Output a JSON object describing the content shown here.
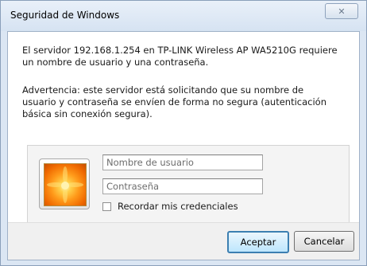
{
  "dialog": {
    "title": "Seguridad de Windows",
    "close_symbol": "☒",
    "message_1": "El servidor 192.168.1.254 en TP-LINK Wireless AP WA5210G requiere un nombre de usuario y una contraseña.",
    "message_2": "Advertencia: este servidor está solicitando que su nombre de usuario y contraseña se envíen de forma no segura (autenticación básica sin conexión segura)."
  },
  "credentials": {
    "avatar_icon": "user-flower-icon",
    "username_placeholder": "Nombre de usuario",
    "password_placeholder": "Contraseña",
    "remember_label": "Recordar mis credenciales"
  },
  "buttons": {
    "ok": "Aceptar",
    "cancel": "Cancelar"
  }
}
